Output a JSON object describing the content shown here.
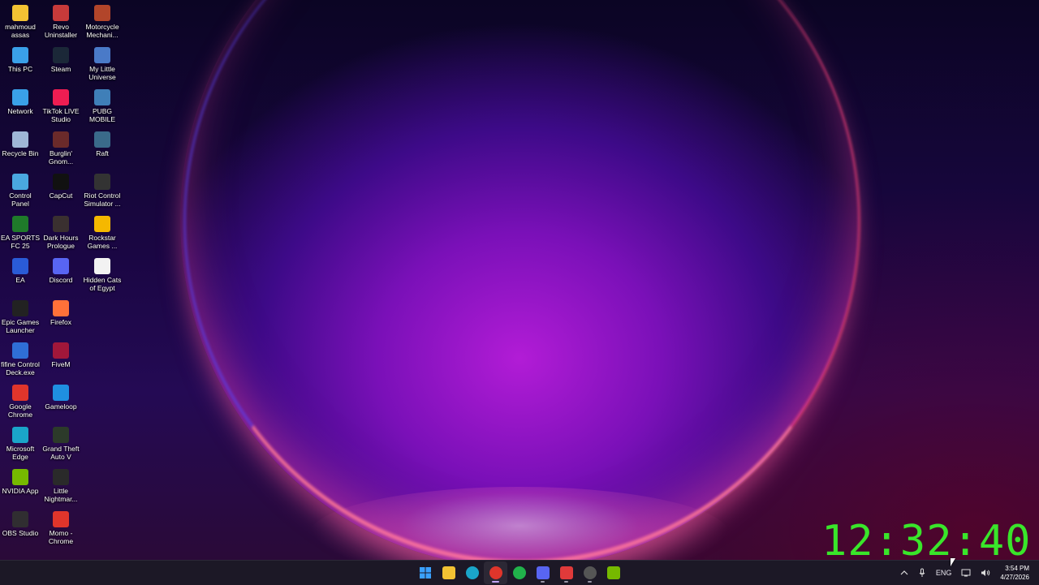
{
  "desktop": {
    "icons": [
      {
        "label": "mahmoud assas",
        "icon": "folder-icon",
        "color": "#f2c233"
      },
      {
        "label": "This PC",
        "icon": "monitor-icon",
        "color": "#3aa0e8"
      },
      {
        "label": "Network",
        "icon": "network-icon",
        "color": "#3aa0e8"
      },
      {
        "label": "Recycle Bin",
        "icon": "recycle-bin-icon",
        "color": "#9fb7d6"
      },
      {
        "label": "Control Panel",
        "icon": "control-panel-icon",
        "color": "#4aa8e0"
      },
      {
        "label": "EA SPORTS FC 25",
        "icon": "ea-fc-icon",
        "color": "#1f7a2a"
      },
      {
        "label": "EA",
        "icon": "ea-icon",
        "color": "#2a5bd7"
      },
      {
        "label": "Epic Games Launcher",
        "icon": "epic-games-icon",
        "color": "#222222"
      },
      {
        "label": "fifine Control Deck.exe",
        "icon": "fifine-icon",
        "color": "#2f6fd6"
      },
      {
        "label": "Google Chrome",
        "icon": "chrome-icon",
        "color": "#e0352b"
      },
      {
        "label": "Microsoft Edge",
        "icon": "edge-icon",
        "color": "#1aa5c9"
      },
      {
        "label": "NVIDIA App",
        "icon": "nvidia-icon",
        "color": "#76b900"
      },
      {
        "label": "OBS Studio",
        "icon": "obs-icon",
        "color": "#302e31"
      },
      {
        "label": "Revo Uninstaller",
        "icon": "revo-uninstaller-icon",
        "color": "#c73a3a"
      },
      {
        "label": "Steam",
        "icon": "steam-icon",
        "color": "#1b2838"
      },
      {
        "label": "TikTok LIVE Studio",
        "icon": "tiktok-icon",
        "color": "#ee1d52"
      },
      {
        "label": "Burglin' Gnom...",
        "icon": "game-icon",
        "color": "#6b2a2a"
      },
      {
        "label": "CapCut",
        "icon": "capcut-icon",
        "color": "#111111"
      },
      {
        "label": "Dark Hours Prologue",
        "icon": "game-icon",
        "color": "#3a3030"
      },
      {
        "label": "Discord",
        "icon": "discord-icon",
        "color": "#5865f2"
      },
      {
        "label": "Firefox",
        "icon": "firefox-icon",
        "color": "#ff7139"
      },
      {
        "label": "FiveM",
        "icon": "fivem-icon",
        "color": "#a1173a"
      },
      {
        "label": "Gameloop",
        "icon": "gameloop-icon",
        "color": "#1f8fe0"
      },
      {
        "label": "Grand Theft Auto V",
        "icon": "gta-icon",
        "color": "#2c3a2a"
      },
      {
        "label": "Little Nightmar...",
        "icon": "game-icon",
        "color": "#2a2a2a"
      },
      {
        "label": "Momo - Chrome",
        "icon": "chrome-app-icon",
        "color": "#e0352b"
      },
      {
        "label": "Motorcycle Mechani...",
        "icon": "game-icon",
        "color": "#b2452a"
      },
      {
        "label": "My Little Universe",
        "icon": "game-icon",
        "color": "#4a7ac8"
      },
      {
        "label": "PUBG MOBILE",
        "icon": "pubg-icon",
        "color": "#3f7fb8"
      },
      {
        "label": "Raft",
        "icon": "raft-icon",
        "color": "#3a6a8a"
      },
      {
        "label": "Riot Control Simulator ...",
        "icon": "game-icon",
        "color": "#333333"
      },
      {
        "label": "Rockstar Games ...",
        "icon": "rockstar-icon",
        "color": "#f5b800"
      },
      {
        "label": "Hidden Cats of Egypt",
        "icon": "game-icon",
        "color": "#f2f2f2"
      }
    ]
  },
  "overlay_clock": "12:32:40",
  "taskbar": {
    "apps": [
      {
        "name": "start",
        "icon": "windows-start-icon",
        "color": "#3aa0ff",
        "active": false,
        "pip": false
      },
      {
        "name": "file-explorer",
        "icon": "folder-icon",
        "color": "#f2c233",
        "active": false,
        "pip": false
      },
      {
        "name": "edge",
        "icon": "edge-icon",
        "color": "#1aa5c9",
        "active": false,
        "pip": false
      },
      {
        "name": "chrome",
        "icon": "chrome-icon",
        "color": "#e0352b",
        "active": true,
        "pip": true
      },
      {
        "name": "app-green",
        "icon": "green-app-icon",
        "color": "#21b24b",
        "active": false,
        "pip": false
      },
      {
        "name": "discord",
        "icon": "discord-icon",
        "color": "#5865f2",
        "active": false,
        "pip": true
      },
      {
        "name": "app-red",
        "icon": "red-app-icon",
        "color": "#e03a3a",
        "active": false,
        "pip": true
      },
      {
        "name": "obs",
        "icon": "obs-icon",
        "color": "#555555",
        "active": false,
        "pip": true
      },
      {
        "name": "nvidia",
        "icon": "nvidia-icon",
        "color": "#76b900",
        "active": false,
        "pip": false
      }
    ],
    "tray": {
      "language": "ENG",
      "time": "3:54 PM",
      "date": "4/27/2026"
    }
  }
}
